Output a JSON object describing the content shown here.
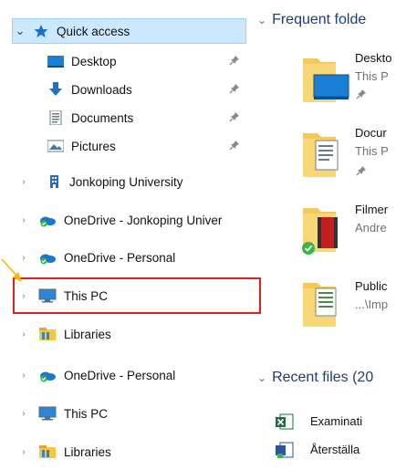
{
  "nav": {
    "items": [
      {
        "label": "Quick access",
        "chevron": "⌄"
      },
      {
        "label": "Desktop"
      },
      {
        "label": "Downloads"
      },
      {
        "label": "Documents"
      },
      {
        "label": "Pictures"
      },
      {
        "label": "Jonkoping University",
        "chevron": "›"
      },
      {
        "label": "OneDrive - Jonkoping Univer",
        "chevron": "›"
      },
      {
        "label": "OneDrive - Personal",
        "chevron": "›"
      },
      {
        "label": "This PC",
        "chevron": "›"
      },
      {
        "label": "Libraries",
        "chevron": "›"
      },
      {
        "label": "OneDrive - Personal",
        "chevron": "›"
      },
      {
        "label": "This PC",
        "chevron": "›"
      },
      {
        "label": "Libraries",
        "chevron": "›"
      }
    ]
  },
  "main": {
    "frequent_header": "Frequent folde",
    "frequent_caret": "⌄",
    "folders": [
      {
        "name": "Deskto",
        "sub": "This P"
      },
      {
        "name": "Docur",
        "sub": "This P"
      },
      {
        "name": "Filmer",
        "sub": "Andre"
      },
      {
        "name": "Public",
        "sub": "...\\Imp"
      }
    ],
    "recent_header": "Recent files (20",
    "recent_caret": "⌄",
    "recent_files": [
      {
        "name": "Examinati"
      },
      {
        "name": "Återställa"
      }
    ]
  },
  "colors": {
    "selection": "#cce8ff",
    "highlight": "#e0201e",
    "section_header": "#1e3c7a",
    "arrow": "#f5b800"
  }
}
